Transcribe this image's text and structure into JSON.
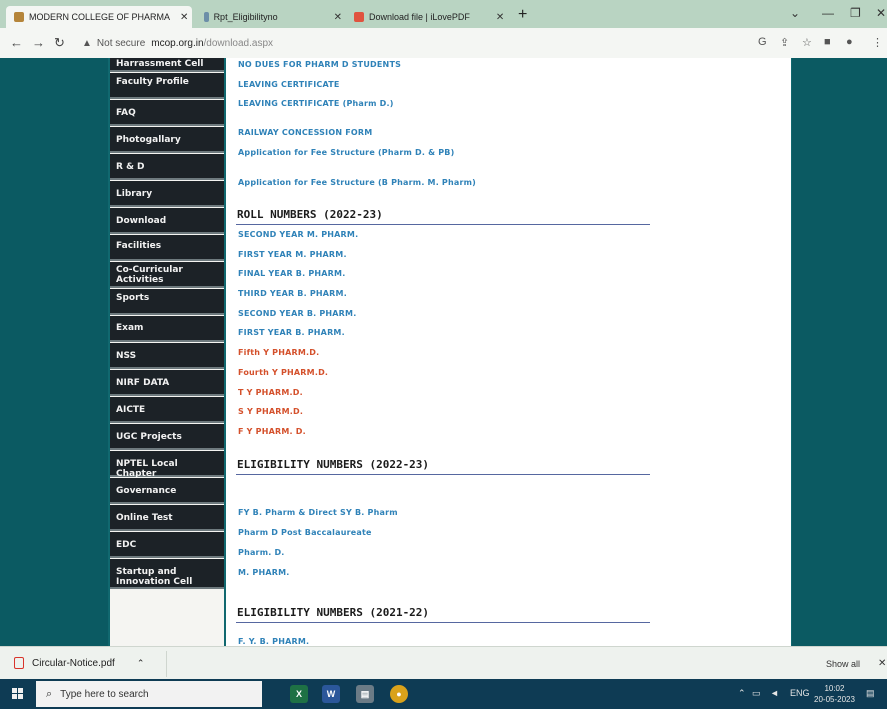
{
  "browser": {
    "tabs": [
      {
        "label": "MODERN COLLEGE OF PHARMA",
        "active": true
      },
      {
        "label": "Rpt_Eligibilityno",
        "active": false
      },
      {
        "label": "Download file | iLovePDF",
        "active": false
      }
    ],
    "new_tab": "+",
    "url_security": "Not secure",
    "url_host": "mcop.org.in",
    "url_path": "/download.aspx"
  },
  "menu": [
    "Harrassment Cell",
    "Faculty Profile",
    "FAQ",
    "Photogallary",
    "R & D",
    "Library",
    "Download",
    "Facilities",
    "Co-Curricular Activities",
    "Sports",
    "Exam",
    "NSS",
    "NIRF DATA",
    "AICTE",
    "UGC Projects",
    "NPTEL Local Chapter",
    "Governance",
    "Online Test",
    "EDC",
    "Startup and Innovation Cell"
  ],
  "content": {
    "top_links": [
      "NO DUES FOR PHARM D STUDENTS",
      "LEAVING CERTIFICATE",
      "LEAVING CERTIFICATE (Pharm D.)",
      "RAILWAY CONCESSION FORM",
      "Application for Fee Structure (Pharm D. & PB)",
      "Application for Fee Structure (B Pharm. M. Pharm)"
    ],
    "roll_title": "ROLL NUMBERS (2022-23)",
    "roll_links": [
      "SECOND YEAR M. PHARM.",
      "FIRST YEAR M. PHARM.",
      "FINAL YEAR B. PHARM.",
      "THIRD YEAR B. PHARM.",
      "SECOND YEAR B. PHARM.",
      "FIRST YEAR B. PHARM.",
      "Fifth Y PHARM.D.",
      "Fourth Y PHARM.D.",
      "T Y PHARM.D.",
      "S Y PHARM.D.",
      "F Y PHARM. D."
    ],
    "elig_title_1": "ELIGIBILITY NUMBERS (2022-23)",
    "elig_links_1": [
      "FY B. Pharm & Direct SY B. Pharm",
      "Pharm D Post Baccalaureate",
      "Pharm. D.",
      "M. PHARM."
    ],
    "elig_title_2": "ELIGIBILITY NUMBERS (2021-22)",
    "elig_links_2": [
      "F. Y. B. PHARM."
    ]
  },
  "download_bar": {
    "file": "Circular-Notice.pdf",
    "show_all": "Show all",
    "close": "✕"
  },
  "taskbar": {
    "search_placeholder": "Type here to search",
    "lang": "ENG",
    "time": "10:02",
    "date": "20-05-2023"
  },
  "colors": {
    "link_blue": "#2f82b8",
    "link_orange": "#d4502b",
    "menu_bg": "#1c2227",
    "page_teal": "#11686f"
  }
}
